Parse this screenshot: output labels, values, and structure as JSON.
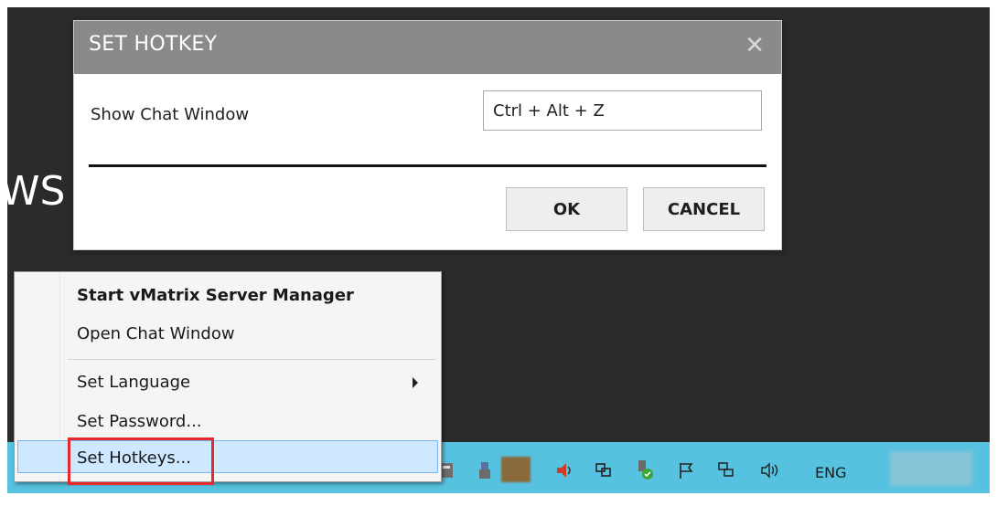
{
  "background": {
    "partial_title": "WS"
  },
  "dialog": {
    "title": "SET HOTKEY",
    "close_glyph": "✕",
    "row_label": "Show Chat Window",
    "hotkey_value": "Ctrl + Alt + Z",
    "ok_label": "OK",
    "cancel_label": "CANCEL"
  },
  "context_menu": {
    "items": [
      {
        "label": "Start vMatrix Server Manager",
        "bold": true
      },
      {
        "label": "Open Chat Window"
      },
      {
        "label": "Set Language",
        "has_submenu": true
      },
      {
        "label": "Set Password..."
      },
      {
        "label": "Set Hotkeys...",
        "highlighted": true
      }
    ]
  },
  "taskbar": {
    "language": "ENG",
    "tray_icons": [
      "network-drive-icon",
      "usb-drive-icon",
      "app-icon",
      "speaker-icon",
      "display-icon",
      "shield-usb-icon",
      "flag-icon",
      "network-icon",
      "speaker-volume-icon"
    ],
    "accent_color": "#57c2e0"
  },
  "colors": {
    "dialog_titlebar": "#8a8a8a",
    "highlight": "#cde8ff",
    "annotation_box": "#e6282d"
  }
}
